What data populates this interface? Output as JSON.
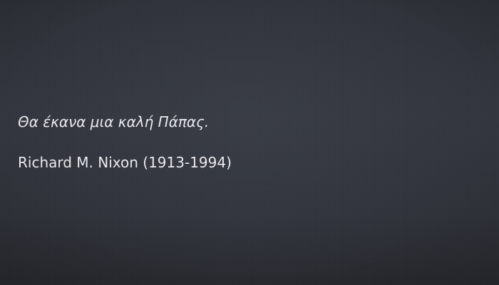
{
  "quote": {
    "text": "Θα έκανα μια καλή Πάπας.",
    "author": "Richard M. Nixon (1913-1994)"
  },
  "colors": {
    "background": "#2e3139",
    "text": "#e9e9ec"
  }
}
